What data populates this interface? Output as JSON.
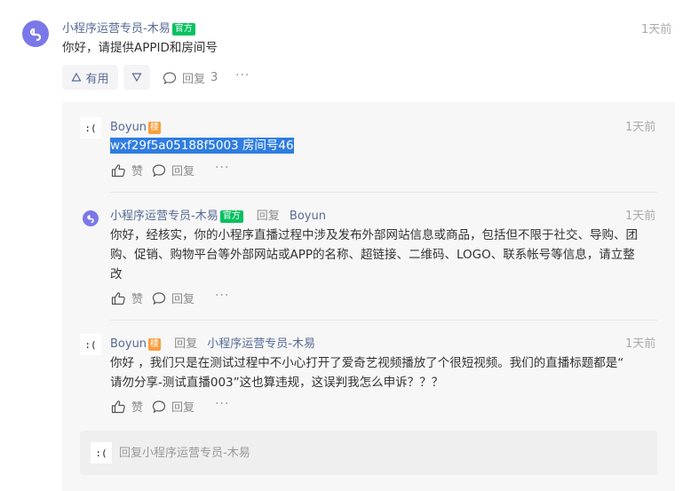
{
  "top_comment": {
    "author": "小程序运营专员-木易",
    "badge": "官方",
    "time": "1天前",
    "text": "你好，请提供APPID和房间号",
    "useful_label": "有用",
    "reply_label": "回复",
    "reply_count": "3",
    "more": "···"
  },
  "replies": [
    {
      "author": "Boyun",
      "badge": "楼",
      "time": "1天前",
      "text": "wxf29f5a05188f5003  房间号46",
      "like_label": "赞",
      "reply_label": "回复",
      "more": "···"
    },
    {
      "author": "小程序运营专员-木易",
      "badge": "官方",
      "reply_word": "回复",
      "reply_to": "Boyun",
      "time": "1天前",
      "text_line1": "你好，经核实，你的小程序直播过程中涉及发布外部网站信息或商品，包括但不限于社交、导购、团",
      "text_line2": "购、促销、购物平台等外部网站或APP的名称、超链接、二维码、LOGO、联系帐号等信息，请立整",
      "text_line3": "改",
      "like_label": "赞",
      "reply_label": "回复",
      "more": "···"
    },
    {
      "author": "Boyun",
      "badge": "楼",
      "reply_word": "回复",
      "reply_to": "小程序运营专员-木易",
      "time": "1天前",
      "text_line1": "你好 ，我们只是在测试过程中不小心打开了爱奇艺视频播放了个很短视频。我们的直播标题都是“",
      "text_line2": "请勿分享-测试直播003”这也算违规，这误判我怎么申诉？？？",
      "like_label": "赞",
      "reply_label": "回复",
      "more": "···"
    }
  ],
  "reply_input": {
    "placeholder": "回复小程序运营专员-木易"
  },
  "face_glyph": ":(",
  "colors": {
    "link": "#576b95",
    "official_badge": "#07c160",
    "floor_badge": "#fa9d3b",
    "avatar": "#7a78e8",
    "highlight": "#2f7de1"
  }
}
